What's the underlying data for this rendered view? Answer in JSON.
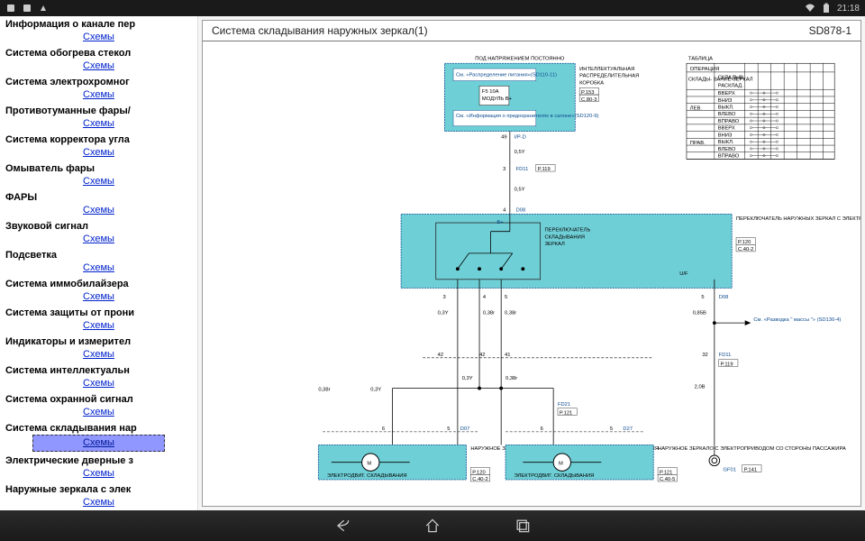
{
  "status": {
    "time": "21:18"
  },
  "sidebar": {
    "link_label": "Схемы",
    "items": [
      {
        "label": "Информация о канале пер"
      },
      {
        "label": "Система обогрева стекол"
      },
      {
        "label": "Система электрохромног"
      },
      {
        "label": "Противотуманные фары/"
      },
      {
        "label": "Система корректора угла"
      },
      {
        "label": "Омыватель фары"
      },
      {
        "label": "ФАРЫ"
      },
      {
        "label": "Звуковой сигнал"
      },
      {
        "label": "Подсветка"
      },
      {
        "label": "Система иммобилайзера"
      },
      {
        "label": "Система защиты от прони"
      },
      {
        "label": "Индикаторы и измерител"
      },
      {
        "label": "Система интеллектуальн"
      },
      {
        "label": "Система охранной сигнал"
      },
      {
        "label": "Система складывания нар",
        "active": true
      },
      {
        "label": "Электрические дверные з"
      },
      {
        "label": "Наружные зеркала с элек"
      }
    ]
  },
  "doc": {
    "title": "Система  складывания  наружных зеркал(1)",
    "code": "SD878-1"
  },
  "diagram": {
    "top_header": "ПОД  НАПРЯЖЕНИЕМ   ПОСТОЯННО",
    "pdb_title1": "ИНТЕЛЛЕКТУАЛЬНАЯ",
    "pdb_title2": "РАСПРЕДЕЛИТЕЛЬНАЯ",
    "pdb_title3": "КОРОБКА",
    "pdb_ref1": "P.153",
    "pdb_ref2": "C.80-3",
    "dist_ref": "См. «Распределение питания»(SD110-11)",
    "fuse": "F5 10A",
    "module": "МОДУЛЬ B+",
    "fuse_info": "См. «Информация о предохранителях в салоне»(SD120-9)",
    "pin49": "49",
    "sig49": "I/P-D",
    "w05y": "0,5Y",
    "fd11": "FD11",
    "p119": "P.119",
    "d08": "D08",
    "b_plus": "B+",
    "sw_title1": "ПЕРЕКЛЮЧАТЕЛЬ",
    "sw_title2": "СКЛАДЫВАНИЯ",
    "sw_title3": "ЗЕРКАЛ",
    "sw_box1": "ПЕРЕКЛЮЧАТЕЛЬ НАРУЖНЫХ ЗЕРКАЛ С ЭЛЕКТРОПРИВОДОМ",
    "sw_ref1": "P.120",
    "sw_ref2": "C.40-2",
    "uf": "U/F",
    "w03yL": "0,3Y",
    "w038rL": "0,38r",
    "w038rR": "0,38r",
    "w085b": "0,85B",
    "gnd_ref": "См. «Разводка \" массы \"» (SD130-4)",
    "d07": "D07",
    "d27": "D27",
    "fd21": "FD21",
    "p121": "P.121",
    "mirror_dr1": "НАРУЖНОЕ  ЗЕРКАЛО С ЭЛЕКТРОПРИ - ВОДОМ  СО СТОРОНЫ ВОДИТЕЛЯ",
    "mirror_dr_ref1": "P.120",
    "mirror_dr_ref2": "C.40-2",
    "mirror_pa1": "НАРУЖНОЕ  ЗЕРКАЛО С ЭЛЕКТРОПРИВОДОМ СО  СТОРОНЫ ПАССАЖИРА",
    "mirror_pa_ref1": "P.121",
    "mirror_pa_ref2": "C.40-5",
    "motor_lbl": "ЭЛЕКТРОДВИГ.  СКЛАДЫВАНИЯ",
    "gf01": "GF01",
    "p141": "P.141",
    "w03y": "0,3Y",
    "w038r": "0,38r",
    "w02b": "2,0B",
    "pins": {
      "p3": "3",
      "p4": "4",
      "p5": "5",
      "p6": "6",
      "p41": "41",
      "p42": "42",
      "p32": "32"
    },
    "table": {
      "title": "ТАБЛИЦА",
      "h1": "ОПЕРАЦИЯ",
      "sub1": "СКЛАДЫ-\nВАНИЕ\nЗЕРКАЛ",
      "su1a": "СКЛАДЫВ.",
      "su1b": "РАСКЛАД.",
      "left_lbl": "ЛЕВ.",
      "right_lbl": "ПРАВ.",
      "rows": [
        "ВВЕРХ",
        "ВНИЗ",
        "ВЫКЛ.",
        "ВЛЕВО",
        "ВПРАВО",
        "ВВЕРХ",
        "ВНИЗ",
        "ВЫКЛ.",
        "ВЛЕВО",
        "ВПРАВО"
      ]
    }
  }
}
